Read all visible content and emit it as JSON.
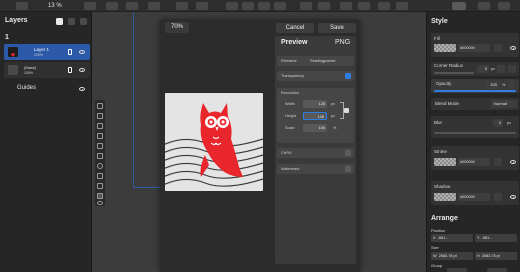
{
  "toolbar": {
    "zoom": "13 %"
  },
  "layers": {
    "title": "Layers",
    "count": "1",
    "items": [
      {
        "name": "Layer 1",
        "opacity": "100%"
      },
      {
        "name": "(Mask)",
        "opacity": "100%"
      }
    ],
    "guides_label": "Guides"
  },
  "export": {
    "zoom": "70%",
    "cancel_label": "Cancel",
    "save_label": "Save",
    "preview_label": "Preview",
    "format": "PNG",
    "filename_label": "Filename",
    "filename_value": "Readingpointer",
    "transparency_label": "Transparency",
    "transparency_checked": true,
    "resolution_label": "Resolution",
    "width_label": "Width",
    "width_value": "128",
    "height_label": "Height",
    "height_value": "128",
    "unit": "px",
    "scale_label": "Scale",
    "scale_value": "100",
    "scale_unit": "%",
    "cmyk_label": "CMYK",
    "cmyk_checked": false,
    "watermark_label": "Watermark",
    "watermark_checked": false
  },
  "style": {
    "title": "Style",
    "fill_label": "Fill",
    "fill_hex": "#000000",
    "corner_radius_label": "Corner Radius",
    "corner_radius_value": "0",
    "corner_radius_unit": "px",
    "opacity_label": "Opacity",
    "opacity_value": "100",
    "opacity_unit": "%",
    "blend_mode_label": "Blend Mode",
    "blend_mode_value": "Normal",
    "blur_label": "Blur",
    "blur_value": "0",
    "blur_unit": "px",
    "stroke_label": "Stroke",
    "stroke_hex": "#000000",
    "shadow_label": "Shadow",
    "shadow_hex": "#000000",
    "arrange_title": "Arrange",
    "position_label": "Position",
    "x_label": "X",
    "x_value": "-681...",
    "y_label": "Y",
    "y_value": "-581...",
    "size_label": "Size",
    "w_label": "W",
    "w_value": "2583.78 pt",
    "h_label": "H",
    "h_value": "2583.78 pt",
    "group_label": "Group"
  },
  "colors": {
    "accent": "#2f7de1",
    "owl": "#e8262b",
    "selected_layer": "#2c5aa8"
  }
}
